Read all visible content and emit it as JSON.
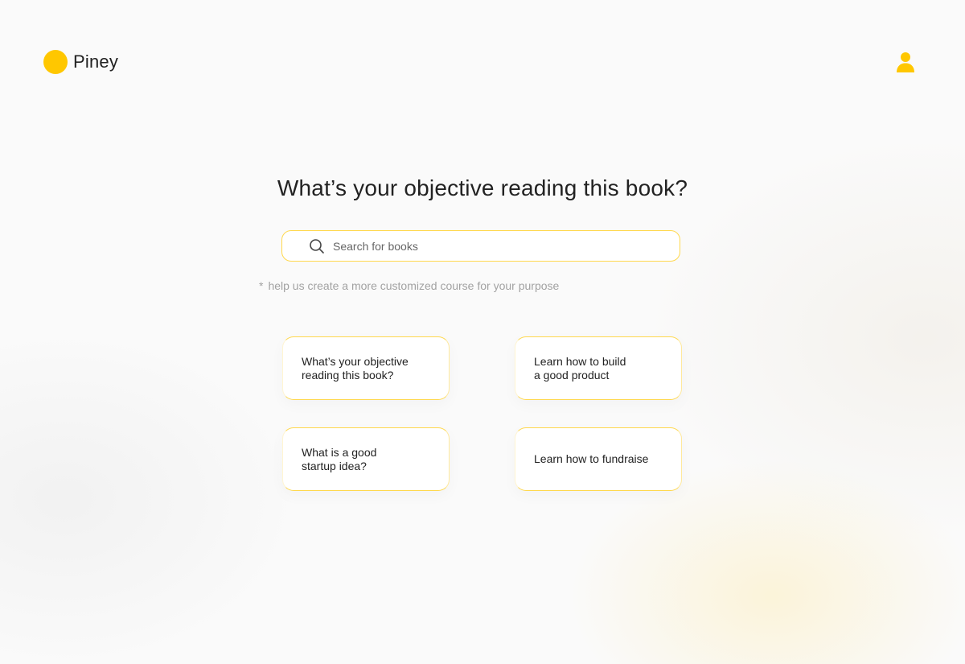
{
  "brand": {
    "name": "Piney",
    "accent": "#FFC700"
  },
  "header": {
    "profile_icon": "user-icon"
  },
  "main": {
    "title": "What’s your objective reading this book?",
    "search": {
      "placeholder": "Search for books",
      "value": ""
    },
    "hint": {
      "marker": "*",
      "text": "help us create a more customized course for your purpose"
    },
    "suggestions": [
      "What’s your objective\nreading this book?",
      "Learn how to build\na good product",
      "What is a good\nstartup idea?",
      "Learn how to fundraise"
    ]
  }
}
